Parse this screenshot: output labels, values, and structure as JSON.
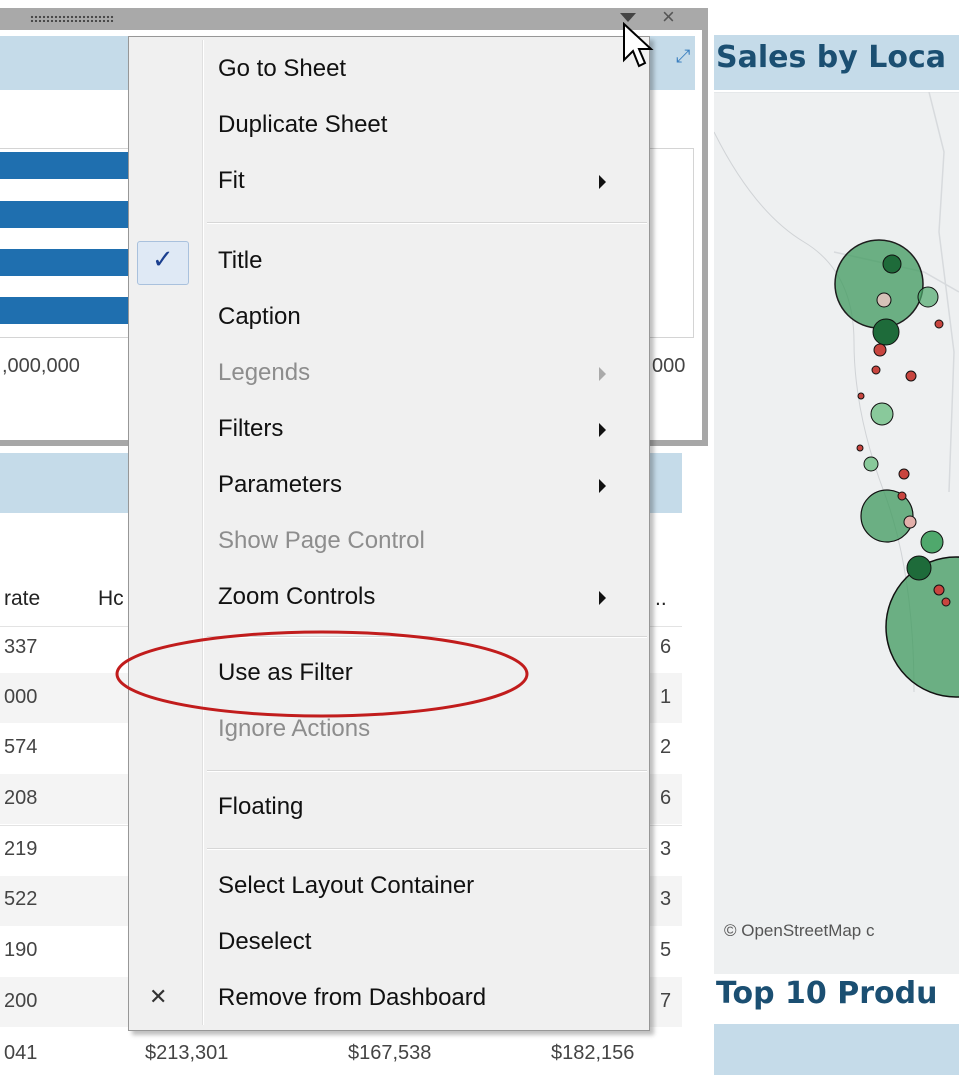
{
  "left_sheet": {
    "axis_labels": [
      ",000,000",
      "000"
    ]
  },
  "table": {
    "headers": [
      "rate",
      "Hc",
      ".."
    ],
    "rows": [
      {
        "c1": "337",
        "c4": "6"
      },
      {
        "c1": "000",
        "c4": "1"
      },
      {
        "c1": "574",
        "c4": "2"
      },
      {
        "c1": "208",
        "c4": "6"
      },
      {
        "c1": "219",
        "c4": "3"
      },
      {
        "c1": "522",
        "c4": "3"
      },
      {
        "c1": "190",
        "c4": "5"
      },
      {
        "c1": "200",
        "c4": "7"
      }
    ],
    "last_row": {
      "c1": "041",
      "c2": "$213,301",
      "c3": "$167,538",
      "c4": "$182,156"
    }
  },
  "map": {
    "title": "Sales by Loca",
    "attribution": "© OpenStreetMap c",
    "next_title": "Top 10 Produ",
    "colors": {
      "band": "#c5dbe9",
      "title": "#1b4f72",
      "green_bubble": "#3f9a5e",
      "red_bubble": "#c8453f"
    }
  },
  "context_menu": {
    "items": [
      {
        "label": "Go to Sheet"
      },
      {
        "label": "Duplicate Sheet"
      },
      {
        "label": "Fit",
        "submenu": true
      },
      {
        "label": "Title",
        "checked": true
      },
      {
        "label": "Caption"
      },
      {
        "label": "Legends",
        "submenu": true,
        "disabled": true
      },
      {
        "label": "Filters",
        "submenu": true
      },
      {
        "label": "Parameters",
        "submenu": true
      },
      {
        "label": "Show Page Control",
        "disabled": true
      },
      {
        "label": "Zoom Controls",
        "submenu": true
      },
      {
        "label": "Use as Filter",
        "highlighted": true
      },
      {
        "label": "Ignore Actions",
        "disabled": true
      },
      {
        "label": "Floating"
      },
      {
        "label": "Select Layout Container"
      },
      {
        "label": "Deselect"
      },
      {
        "label": "Remove from Dashboard",
        "icon": "remove-x-icon"
      }
    ]
  },
  "icons": {
    "menu_caret": "caret-down-icon",
    "close": "close-icon",
    "expand": "expand-icon",
    "cursor": "cursor-pointer-icon"
  }
}
